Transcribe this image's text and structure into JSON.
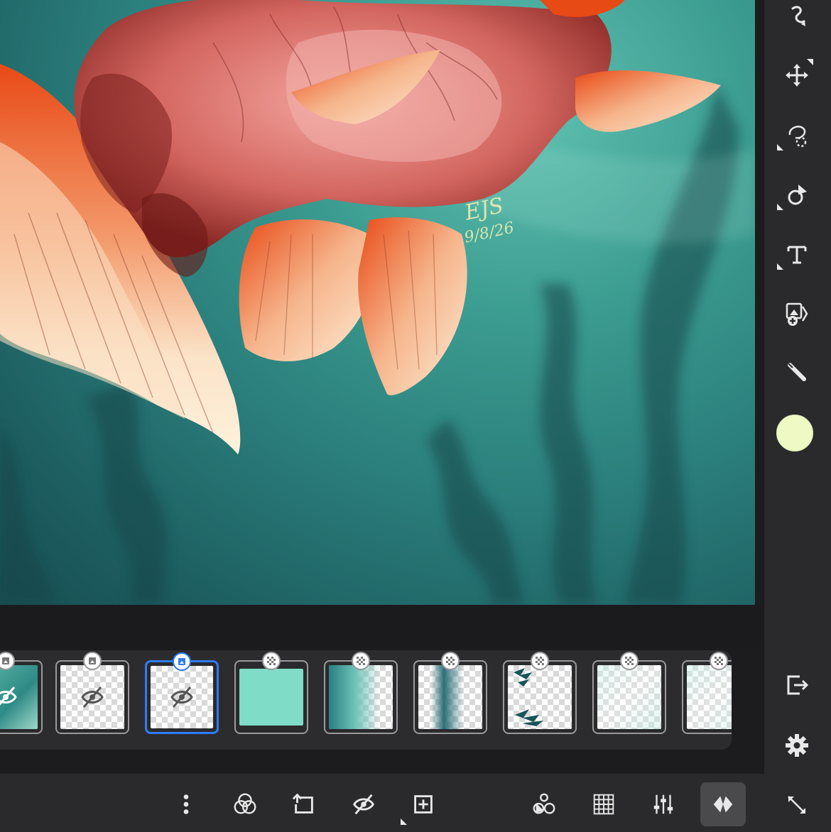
{
  "canvas": {
    "artwork": "goldfish-painting",
    "signature_initials": "EJS",
    "signature_date": "9/8/26",
    "background_color": "#2b7f7c"
  },
  "right_rail": {
    "tools": [
      {
        "name": "smudge-icon"
      },
      {
        "name": "transform-icon"
      },
      {
        "name": "lasso-select-icon"
      },
      {
        "name": "fill-icon"
      },
      {
        "name": "text-icon"
      },
      {
        "name": "import-image-icon"
      },
      {
        "name": "eyedropper-icon"
      }
    ],
    "current_color": "#eef9c3",
    "bottom_tools": [
      {
        "name": "export-icon"
      },
      {
        "name": "settings-gear-icon"
      },
      {
        "name": "fullscreen-icon"
      }
    ]
  },
  "layers": {
    "thumbnails": [
      {
        "id": 1,
        "kind": "image",
        "hidden": true,
        "selected": false
      },
      {
        "id": 2,
        "kind": "image",
        "hidden": true,
        "selected": false
      },
      {
        "id": 3,
        "kind": "image",
        "hidden": true,
        "selected": true
      },
      {
        "id": 4,
        "kind": "paint",
        "hidden": false,
        "selected": false,
        "fill": "#7fdcc7"
      },
      {
        "id": 5,
        "kind": "paint",
        "hidden": false,
        "selected": false
      },
      {
        "id": 6,
        "kind": "paint",
        "hidden": false,
        "selected": false
      },
      {
        "id": 7,
        "kind": "paint",
        "hidden": false,
        "selected": false
      },
      {
        "id": 8,
        "kind": "paint",
        "hidden": false,
        "selected": false
      },
      {
        "id": 9,
        "kind": "paint",
        "hidden": false,
        "selected": false
      }
    ]
  },
  "bottom_toolbar": {
    "buttons": [
      {
        "name": "more-options-icon"
      },
      {
        "name": "blend-mode-icon"
      },
      {
        "name": "merge-down-icon"
      },
      {
        "name": "hide-layer-icon"
      },
      {
        "name": "add-layer-icon"
      },
      {
        "name": "layer-effects-icon"
      },
      {
        "name": "grid-icon"
      },
      {
        "name": "adjustments-sliders-icon"
      },
      {
        "name": "layers-toggle-icon"
      }
    ],
    "active_button": "layers-toggle-icon"
  }
}
